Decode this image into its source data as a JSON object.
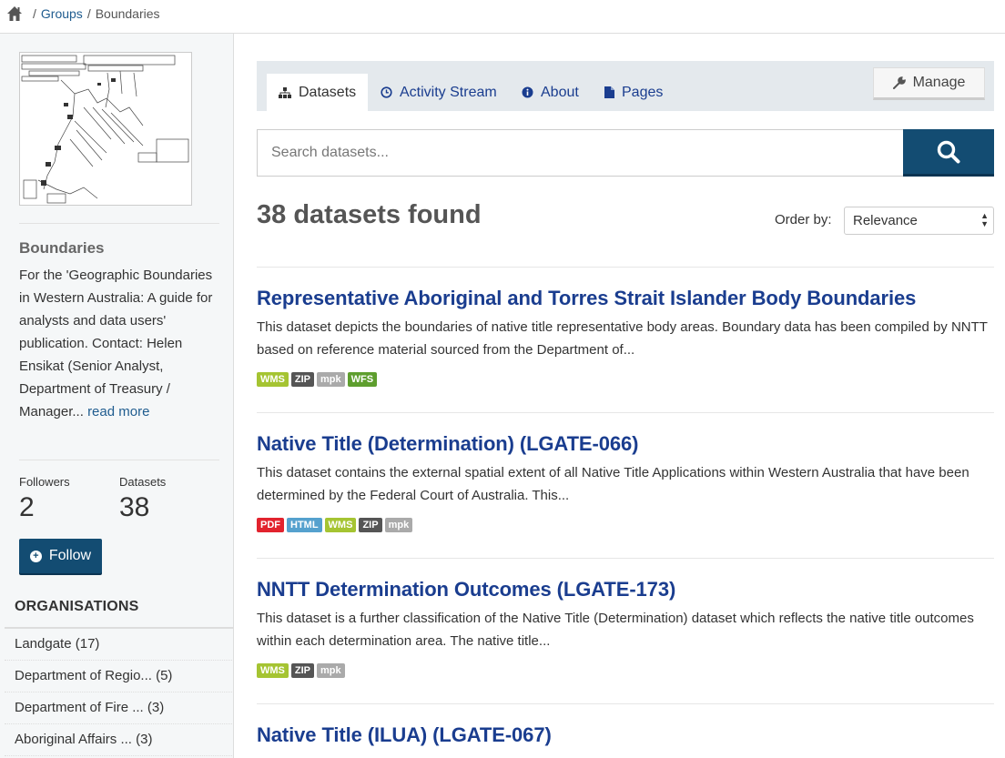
{
  "breadcrumb": {
    "home": "home-icon",
    "groups": "Groups",
    "current": "Boundaries",
    "separator": "/"
  },
  "sidebar": {
    "title": "Boundaries",
    "description": "For the 'Geographic Boundaries in Western Australia: A guide for analysts and data users' publication. Contact: Helen Ensikat (Senior Analyst, Department of Treasury / Manager...",
    "read_more": "read more",
    "followers_label": "Followers",
    "followers_value": "2",
    "datasets_label": "Datasets",
    "datasets_value": "38",
    "follow_label": "Follow",
    "organisations_heading": "ORGANISATIONS",
    "organisations": [
      "Landgate (17)",
      "Department of Regio... (5)",
      "Department of Fire ... (3)",
      "Aboriginal Affairs ... (3)"
    ]
  },
  "tabs": {
    "datasets": "Datasets",
    "activity": "Activity Stream",
    "about": "About",
    "pages": "Pages",
    "manage": "Manage"
  },
  "search": {
    "placeholder": "Search datasets..."
  },
  "results": {
    "count_text": "38 datasets found",
    "order_label": "Order by:",
    "order_value": "Relevance"
  },
  "colors": {
    "brand": "#134c72",
    "link": "#1a3d8f",
    "WMS": "#a5c432",
    "ZIP": "#555555",
    "mpk": "#aaaaaa",
    "WFS": "#5e9e2e",
    "PDF": "#e2232e",
    "HTML": "#55a1ce"
  },
  "datasets": [
    {
      "title": "Representative Aboriginal and Torres Strait Islander Body Boundaries",
      "description": "This dataset depicts the boundaries of native title representative body areas. Boundary data has been compiled by NNTT based on reference material sourced from the Department of...",
      "formats": [
        "WMS",
        "ZIP",
        "mpk",
        "WFS"
      ]
    },
    {
      "title": "Native Title (Determination) (LGATE-066)",
      "description": "This dataset contains the external spatial extent of all Native Title Applications within Western Australia that have been determined by the Federal Court of Australia. This...",
      "formats": [
        "PDF",
        "HTML",
        "WMS",
        "ZIP",
        "mpk"
      ]
    },
    {
      "title": "NNTT Determination Outcomes (LGATE-173)",
      "description": "This dataset is a further classification of the Native Title (Determination) dataset which reflects the native title outcomes within each determination area. The native title...",
      "formats": [
        "WMS",
        "ZIP",
        "mpk"
      ]
    },
    {
      "title": "Native Title (ILUA) (LGATE-067)",
      "description": "",
      "formats": []
    }
  ]
}
